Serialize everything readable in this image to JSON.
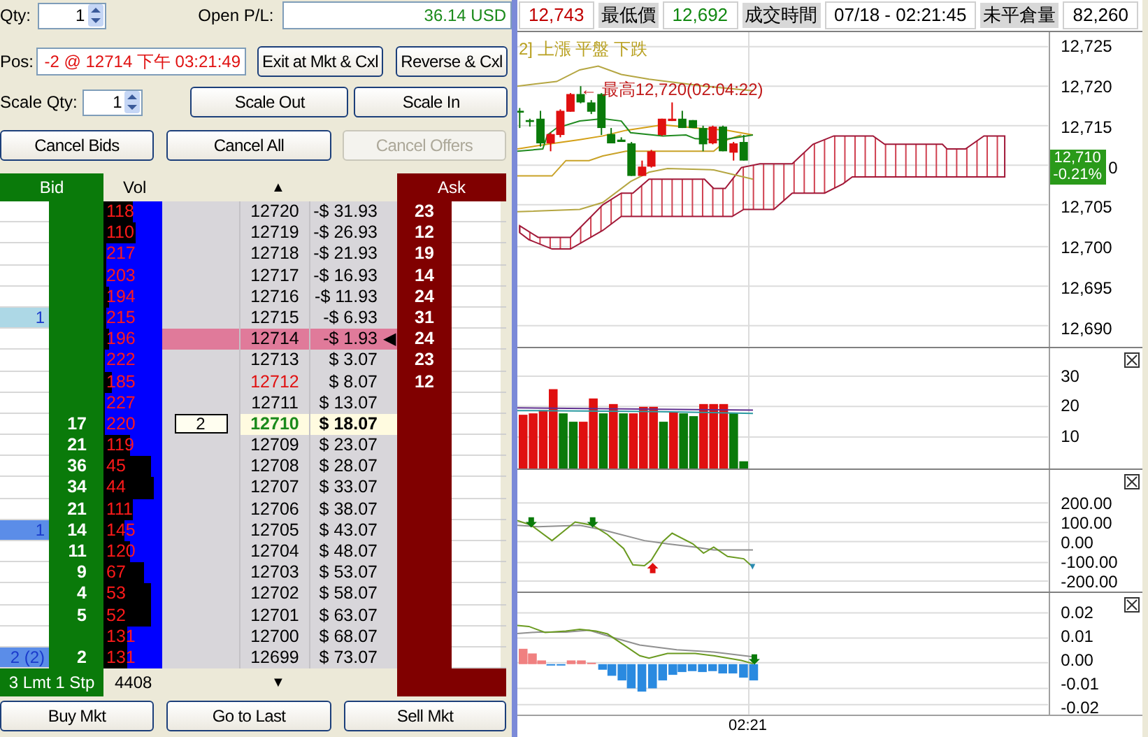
{
  "order_entry": {
    "qty_label": "Qty:",
    "qty": "1",
    "open_pl_label": "Open P/L:",
    "open_pl": "36.14 USD",
    "pos_label": "Pos:",
    "pos": "-2 @ 12714 下午 03:21:49",
    "scale_qty_label": "Scale Qty:",
    "scale_qty": "1"
  },
  "buttons": [
    {
      "label": "Exit at Mkt & Cxl",
      "disabled": false
    },
    {
      "label": "Reverse & Cxl",
      "disabled": false
    },
    {
      "label": "Scale Out",
      "disabled": false
    },
    {
      "label": "Scale In",
      "disabled": false
    },
    {
      "label": "Cancel Bids",
      "disabled": false
    },
    {
      "label": "Cancel All",
      "disabled": false
    },
    {
      "label": "Cancel Offers",
      "disabled": true
    }
  ],
  "ladder": {
    "headers": {
      "bid": "Bid",
      "vol": "Vol",
      "scroll_up": "▲",
      "ask": "Ask"
    },
    "rows": [
      {
        "vol": "118",
        "level": 0.5,
        "price": "12720",
        "pnl": "-$ 31.93",
        "ask": "23",
        "kind": "normal"
      },
      {
        "vol": "110",
        "level": 0.45,
        "price": "12719",
        "pnl": "-$ 26.93",
        "ask": "12",
        "kind": "normal"
      },
      {
        "vol": "217",
        "level": 0.95,
        "price": "12718",
        "pnl": "-$ 21.93",
        "ask": "19",
        "kind": "normal"
      },
      {
        "vol": "203",
        "level": 0.95,
        "price": "12717",
        "pnl": "-$ 16.93",
        "ask": "14",
        "kind": "normal"
      },
      {
        "vol": "194",
        "level": 0.9,
        "price": "12716",
        "pnl": "-$ 11.93",
        "ask": "24",
        "kind": "normal"
      },
      {
        "buy_order": {
          "text": "1",
          "color": "#add8e6"
        },
        "vol": "215",
        "level": 0.95,
        "price": "12715",
        "pnl": "-$ 6.93",
        "ask": "31",
        "kind": "normal"
      },
      {
        "vol": "196",
        "level": 0.9,
        "price": "12714",
        "pnl": "-$ 1.93",
        "marker": "◀",
        "ask": "24",
        "kind": "position"
      },
      {
        "vol": "222",
        "level": 0.97,
        "price": "12713",
        "pnl": "$ 3.07",
        "ask": "23",
        "kind": "normal"
      },
      {
        "vol": "185",
        "level": 0.85,
        "price": "12712",
        "pnl": "$ 8.07",
        "ask": "12",
        "kind": "marked"
      },
      {
        "vol": "227",
        "level": 0.97,
        "price": "12711",
        "pnl": "$ 13.07",
        "kind": "normal"
      },
      {
        "bid": "17",
        "vol": "220",
        "level": 0.97,
        "working_order": "2",
        "price": "12710",
        "pnl": "$ 18.07",
        "kind": "last"
      },
      {
        "bid": "21",
        "vol": "119",
        "level": 0.55,
        "price": "12709",
        "pnl": "$ 23.07",
        "kind": "normal"
      },
      {
        "bid": "36",
        "vol": "45",
        "level": 0.2,
        "price": "12708",
        "pnl": "$ 28.07",
        "kind": "normal"
      },
      {
        "bid": "34",
        "vol": "44",
        "level": 0.15,
        "price": "12707",
        "pnl": "$ 33.07",
        "kind": "normal"
      },
      {
        "bid": "21",
        "vol": "111",
        "level": 0.5,
        "price": "12706",
        "pnl": "$ 38.07",
        "kind": "normal"
      },
      {
        "buy_order": {
          "text": "1",
          "color": "#5b8de8"
        },
        "bid": "14",
        "vol": "145",
        "level": 0.65,
        "price": "12705",
        "pnl": "$ 43.07",
        "kind": "normal"
      },
      {
        "bid": "11",
        "vol": "120",
        "level": 0.55,
        "price": "12704",
        "pnl": "$ 48.07",
        "kind": "normal"
      },
      {
        "bid": "9",
        "vol": "67",
        "level": 0.3,
        "price": "12703",
        "pnl": "$ 53.07",
        "kind": "normal"
      },
      {
        "bid": "4",
        "vol": "53",
        "level": 0.2,
        "price": "12702",
        "pnl": "$ 58.07",
        "kind": "normal"
      },
      {
        "bid": "5",
        "vol": "52",
        "level": 0.2,
        "price": "12701",
        "pnl": "$ 63.07",
        "kind": "normal"
      },
      {
        "vol": "131",
        "level": 0.6,
        "price": "12700",
        "pnl": "$ 68.07",
        "kind": "normal"
      },
      {
        "buy_order": {
          "text": "2 (2)",
          "color": "#5b8de8"
        },
        "bid": "2",
        "vol": "131",
        "level": 0.6,
        "price": "12699",
        "pnl": "$ 73.07",
        "kind": "normal"
      }
    ],
    "footer": {
      "orders": "3 Lmt 1 Stp",
      "volume": "4408",
      "scroll_down": "▼"
    }
  },
  "bottom_buttons": [
    {
      "label": "Buy Mkt"
    },
    {
      "label": "Go to Last"
    },
    {
      "label": "Sell Mkt"
    }
  ],
  "quote_bar": [
    {
      "kind": "value",
      "text": "12,743",
      "color": "#c00000"
    },
    {
      "kind": "label",
      "text": "最低價"
    },
    {
      "kind": "value",
      "text": "12,692",
      "color": "#118811"
    },
    {
      "kind": "label",
      "text": "成交時間"
    },
    {
      "kind": "value",
      "text": "07/18  -  02:21:45",
      "color": "#000000"
    },
    {
      "kind": "label",
      "text": "未平倉量"
    },
    {
      "kind": "value",
      "text": "82,260",
      "color": "#000000"
    }
  ],
  "chart": {
    "legend": "2] 上漲  平盤  下跌",
    "annotation": "← 最高12,720(02:04:22)",
    "price_ticks": [
      {
        "kind": "tick",
        "label": "12,725"
      },
      {
        "kind": "tick",
        "label": "12,720"
      },
      {
        "kind": "tick",
        "label": "12,715"
      },
      {
        "kind": "badge",
        "last_price": "12,710",
        "change": "-0.21%",
        "tail": "0"
      },
      {
        "kind": "tick",
        "label": "12,705"
      },
      {
        "kind": "tick",
        "label": "12,700"
      },
      {
        "kind": "tick",
        "label": "12,695"
      },
      {
        "kind": "tick",
        "label": "12,690"
      }
    ],
    "volume_ticks": [
      "30",
      "20",
      "10"
    ],
    "cci_ticks": [
      "200.00",
      "100.00",
      "0.00",
      "-100.00",
      "-200.00"
    ],
    "macd_ticks": [
      "0.02",
      "0.01",
      "0.00",
      "-0.01",
      "-0.02"
    ],
    "time_label": "02:21"
  }
}
